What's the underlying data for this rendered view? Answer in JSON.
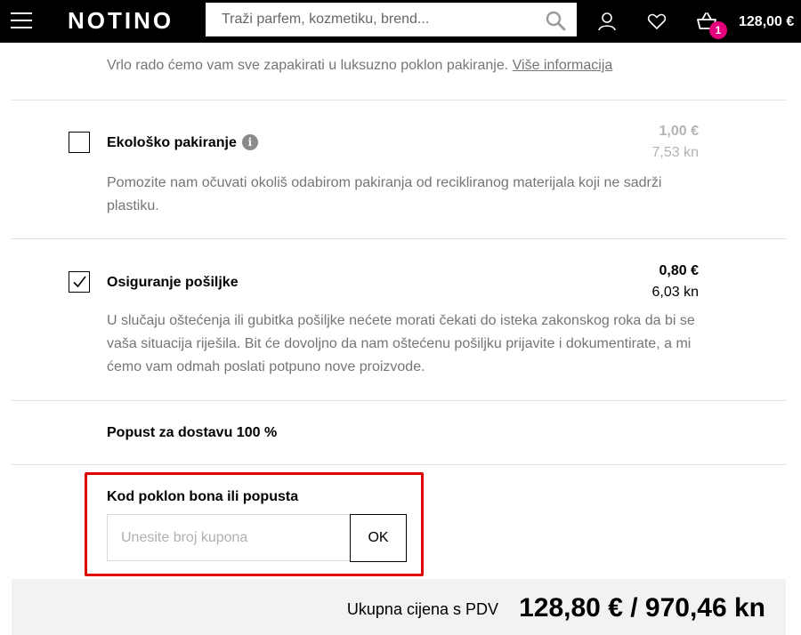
{
  "header": {
    "logo": "NOTINO",
    "search_placeholder": "Traži parfem, kozmetiku, brend...",
    "cart_count": "1",
    "cart_total": "128,00 €"
  },
  "gift_wrap": {
    "description": "Vrlo rado ćemo vam sve zapakirati u luksuzno poklon pakiranje.",
    "more_info_link": "Više informacija"
  },
  "options": [
    {
      "title": "Ekološko pakiranje",
      "checked": false,
      "price_eur": "1,00 €",
      "price_kn": "7,53 kn",
      "description": "Pomozite nam očuvati okoliš odabirom pakiranja od recikliranog materijala koji ne sadrži plastiku."
    },
    {
      "title": "Osiguranje pošiljke",
      "checked": true,
      "price_eur": "0,80 €",
      "price_kn": "6,03 kn",
      "description": "U slučaju oštećenja ili gubitka pošiljke nećete morati čekati do isteka zakonskog roka da bi se vaša situacija riješila. Bit će dovoljno da nam oštećenu pošiljku prijavite i dokumentirate, a mi ćemo vam odmah poslati potpuno nove proizvode."
    }
  ],
  "shipping_discount": "Popust za dostavu 100 %",
  "coupon": {
    "title": "Kod poklon bona ili popusta",
    "placeholder": "Unesite broj kupona",
    "button_label": "OK"
  },
  "total": {
    "label": "Ukupna cijena s PDV",
    "value": "128,80 € / 970,46 kn"
  },
  "colors": {
    "brand_black": "#000000",
    "badge_pink": "#e4007c",
    "highlight_red": "#e00000"
  }
}
